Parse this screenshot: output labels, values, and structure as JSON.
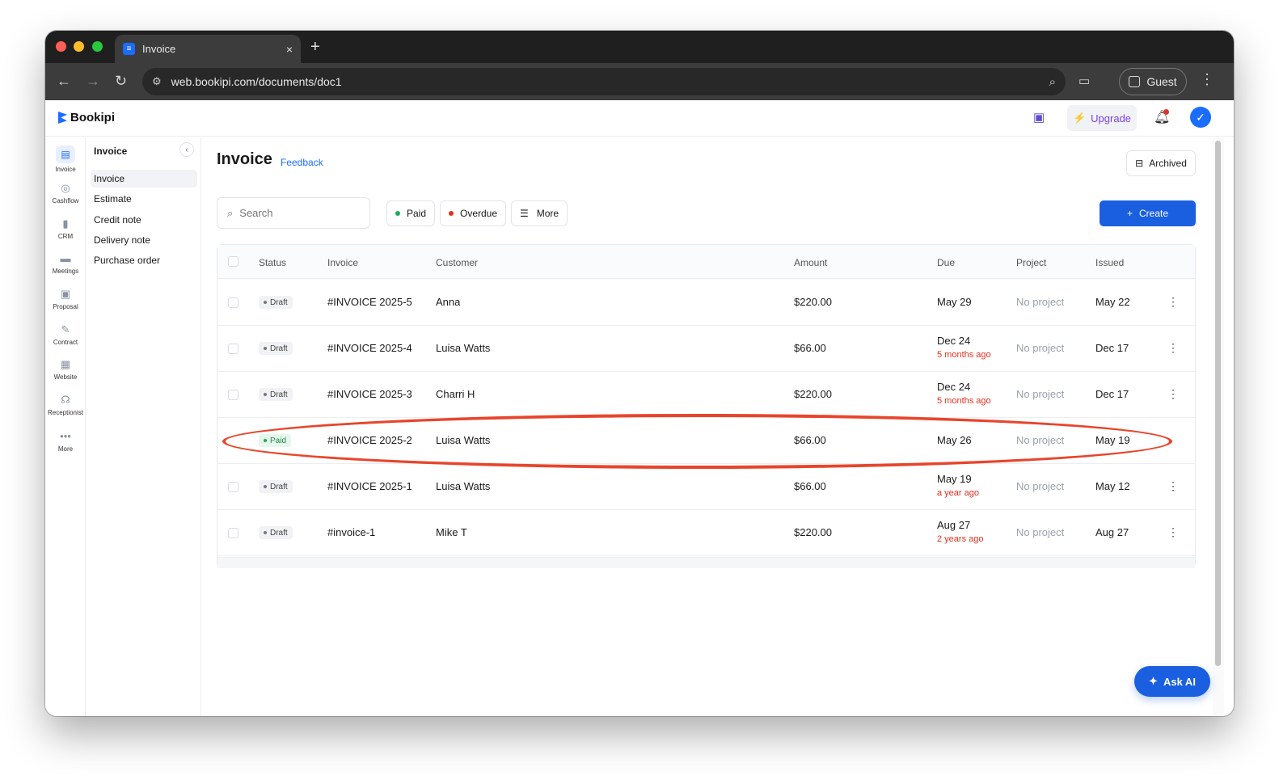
{
  "browser": {
    "tab_title": "Invoice",
    "tab_close": "×",
    "new_tab": "+",
    "url": "web.bookipi.com/documents/doc1",
    "profile_label": "Guest"
  },
  "app": {
    "brand": "Bookipi",
    "upgrade_label": "Upgrade",
    "rail": [
      {
        "label": "Invoice",
        "icon": "invoice-icon"
      },
      {
        "label": "Cashflow",
        "icon": "cashflow-icon"
      },
      {
        "label": "CRM",
        "icon": "crm-icon"
      },
      {
        "label": "Meetings",
        "icon": "meetings-icon"
      },
      {
        "label": "Proposal",
        "icon": "proposal-icon"
      },
      {
        "label": "Contract",
        "icon": "contract-icon"
      },
      {
        "label": "Website",
        "icon": "website-icon"
      },
      {
        "label": "Receptionist",
        "icon": "receptionist-icon"
      },
      {
        "label": "More",
        "icon": "more-icon"
      }
    ],
    "subnav": {
      "title": "Invoice",
      "items": [
        "Invoice",
        "Estimate",
        "Credit note",
        "Delivery note",
        "Purchase order"
      ]
    },
    "page": {
      "title": "Invoice",
      "feedback": "Feedback",
      "archived": "Archived",
      "search_placeholder": "Search",
      "filters": {
        "paid": "Paid",
        "overdue": "Overdue",
        "more": "More"
      },
      "create": "Create"
    },
    "table": {
      "headers": {
        "status": "Status",
        "invoice": "Invoice",
        "customer": "Customer",
        "amount": "Amount",
        "due": "Due",
        "project": "Project",
        "issued": "Issued"
      },
      "rows": [
        {
          "status": "Draft",
          "invoice": "#INVOICE 2025-5",
          "customer": "Anna",
          "amount": "$220.00",
          "due": "May 29",
          "due_note": "",
          "project": "No project",
          "issued": "May 22"
        },
        {
          "status": "Draft",
          "invoice": "#INVOICE 2025-4",
          "customer": "Luisa Watts",
          "amount": "$66.00",
          "due": "Dec 24",
          "due_note": "5 months ago",
          "project": "No project",
          "issued": "Dec 17"
        },
        {
          "status": "Draft",
          "invoice": "#INVOICE 2025-3",
          "customer": "Charri H",
          "amount": "$220.00",
          "due": "Dec 24",
          "due_note": "5 months ago",
          "project": "No project",
          "issued": "Dec 17"
        },
        {
          "status": "Paid",
          "invoice": "#INVOICE 2025-2",
          "customer": "Luisa Watts",
          "amount": "$66.00",
          "due": "May 26",
          "due_note": "",
          "project": "No project",
          "issued": "May 19"
        },
        {
          "status": "Draft",
          "invoice": "#INVOICE 2025-1",
          "customer": "Luisa Watts",
          "amount": "$66.00",
          "due": "May 19",
          "due_note": "a year ago",
          "project": "No project",
          "issued": "May 12"
        },
        {
          "status": "Draft",
          "invoice": "#invoice-1",
          "customer": "Mike T",
          "amount": "$220.00",
          "due": "Aug 27",
          "due_note": "2 years ago",
          "project": "No project",
          "issued": "Aug 27"
        }
      ]
    },
    "ask_ai": "Ask AI"
  },
  "colors": {
    "accent": "#1a5fe0",
    "paid_green": "#1faa59",
    "overdue_red": "#e0301e",
    "annotation_red": "#e8452c"
  }
}
